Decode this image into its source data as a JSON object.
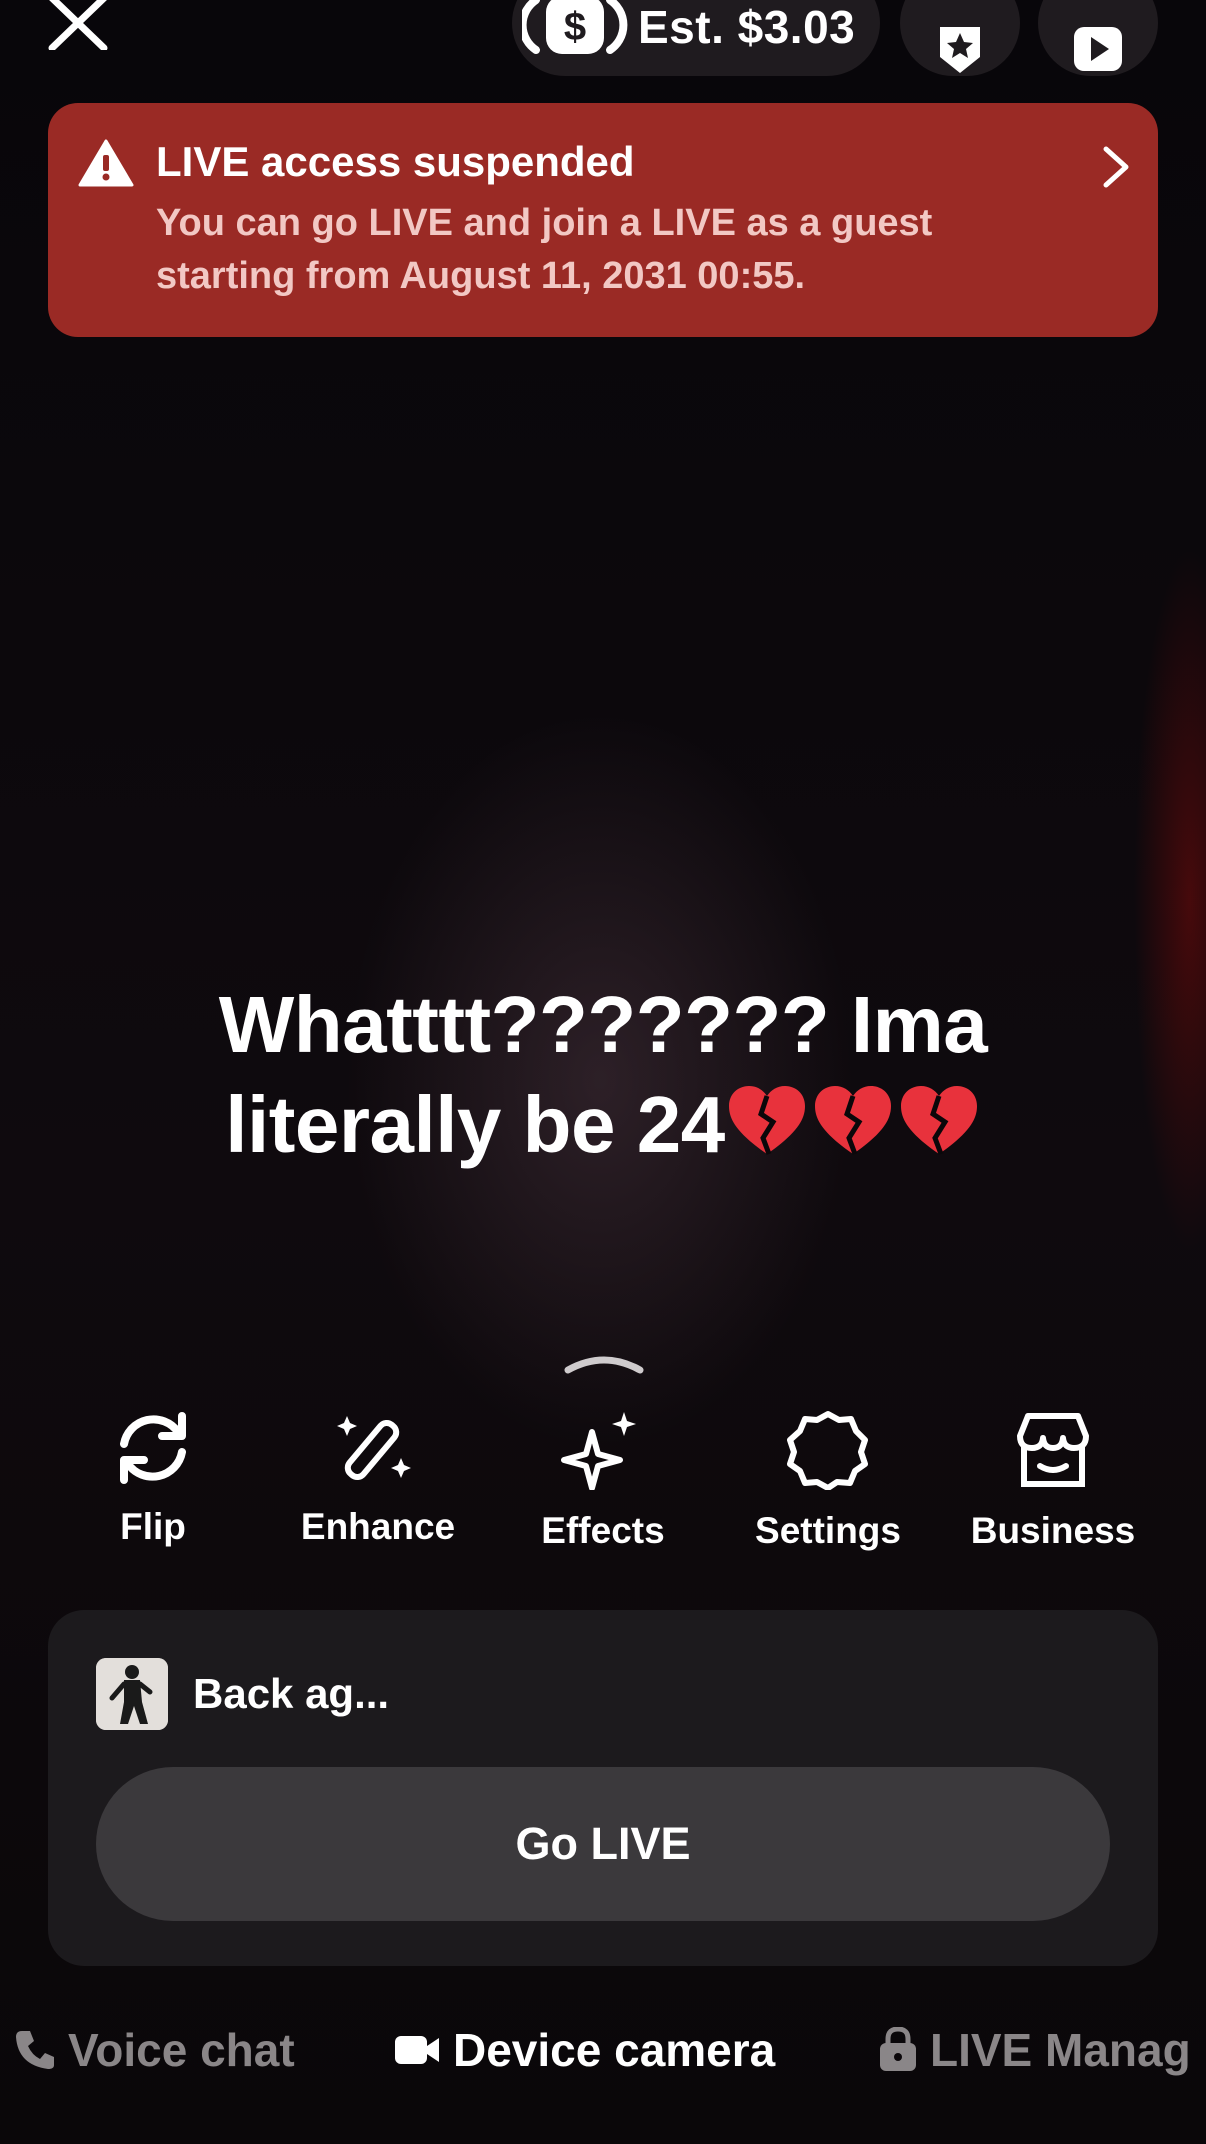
{
  "topbar": {
    "estimate": "Est. $3.03"
  },
  "banner": {
    "title": "LIVE access suspended",
    "body": "You can go LIVE and join a LIVE as a guest starting from August 11, 2031 00:55."
  },
  "overlay_text": {
    "line1": "Whatttt??????? Ima",
    "line2": "literally be 24"
  },
  "toolbar": {
    "items": [
      {
        "label": "Flip",
        "icon": "flip-camera-icon"
      },
      {
        "label": "Enhance",
        "icon": "enhance-wand-icon"
      },
      {
        "label": "Effects",
        "icon": "effects-sparkle-icon"
      },
      {
        "label": "Settings",
        "icon": "settings-gear-icon"
      },
      {
        "label": "Business",
        "icon": "business-store-icon"
      }
    ]
  },
  "card": {
    "title": "Back ag...",
    "go_live_label": "Go LIVE"
  },
  "modes": {
    "items": [
      {
        "label": "Voice chat",
        "icon": "phone-icon",
        "active": false
      },
      {
        "label": "Device camera",
        "icon": "video-camera-icon",
        "active": true
      },
      {
        "label": "LIVE Manag",
        "icon": "lock-icon",
        "active": false
      }
    ]
  },
  "colors": {
    "banner_bg": "#9a2a25",
    "background": "#0b070a",
    "card_bg": "#1c1a1d",
    "button_bg": "#3b393c",
    "inactive_text": "#8a8688"
  }
}
